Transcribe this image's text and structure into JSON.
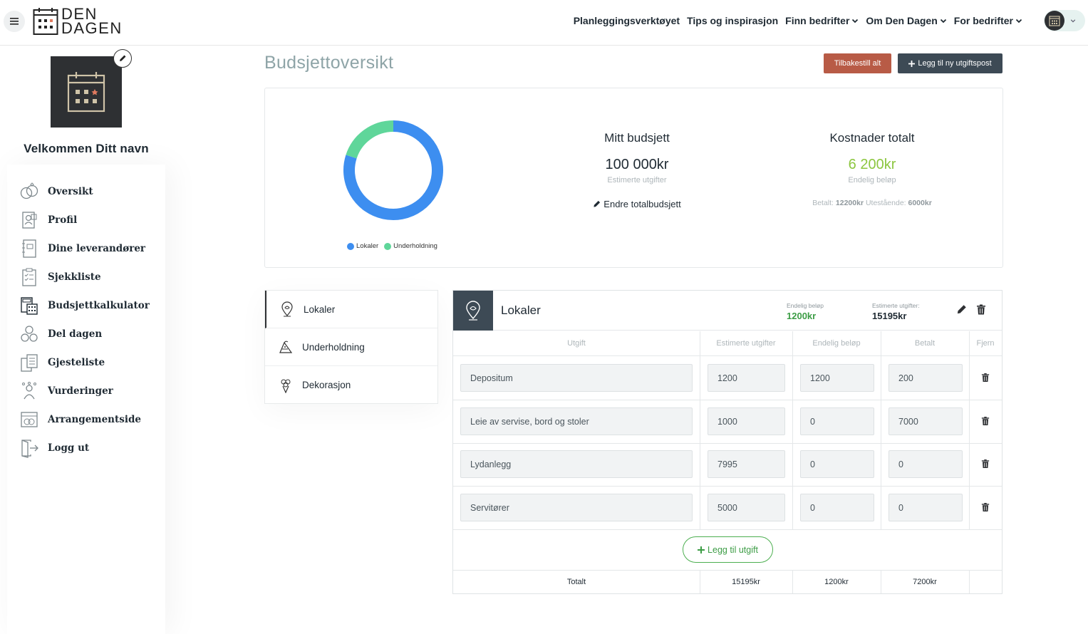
{
  "header": {
    "logo_line1": "DEN",
    "logo_line2": "DAGEN",
    "nav": [
      {
        "label": "Planleggingsverktøyet",
        "dropdown": false
      },
      {
        "label": "Tips og inspirasjon",
        "dropdown": false
      },
      {
        "label": "Finn bedrifter",
        "dropdown": true
      },
      {
        "label": "Om Den Dagen",
        "dropdown": true
      },
      {
        "label": "For bedrifter",
        "dropdown": true
      }
    ]
  },
  "sidebar": {
    "welcome": "Velkommen Ditt navn",
    "items": [
      {
        "label": "Oversikt",
        "icon": "rings-icon"
      },
      {
        "label": "Profil",
        "icon": "profile-icon"
      },
      {
        "label": "Dine leverandører",
        "icon": "notebook-icon"
      },
      {
        "label": "Sjekkliste",
        "icon": "checklist-icon"
      },
      {
        "label": "Budsjettkalkulator",
        "icon": "calculator-icon"
      },
      {
        "label": "Del dagen",
        "icon": "share-icon"
      },
      {
        "label": "Gjesteliste",
        "icon": "guestlist-icon"
      },
      {
        "label": "Vurderinger",
        "icon": "rating-icon"
      },
      {
        "label": "Arrangementside",
        "icon": "event-page-icon"
      },
      {
        "label": "Logg ut",
        "icon": "logout-icon"
      }
    ]
  },
  "main": {
    "title": "Budsjettoversikt",
    "reset_label": "Tilbakestill alt",
    "add_post_label": "Legg til ny utgiftspost"
  },
  "summary": {
    "budget_title": "Mitt budsjett",
    "budget_value": "100 000kr",
    "budget_sub": "Estimerte utgifter",
    "edit_total": "Endre totalbudsjett",
    "cost_title": "Kostnader totalt",
    "cost_value": "6 200kr",
    "cost_sub": "Endelig beløp",
    "paid_label": "Betalt:",
    "paid_value": "12200kr",
    "outstanding_label": "Utestående:",
    "outstanding_value": "6000kr",
    "legend": [
      {
        "label": "Lokaler",
        "color": "#3d8ef0"
      },
      {
        "label": "Underholdning",
        "color": "#5fd69a"
      }
    ]
  },
  "chart_data": {
    "type": "pie",
    "categories": [
      "Lokaler",
      "Underholdning"
    ],
    "values": [
      80,
      20
    ],
    "colors": [
      "#3d8ef0",
      "#5fd69a"
    ],
    "donut": true
  },
  "categories": [
    {
      "label": "Lokaler",
      "icon": "location-pin-icon",
      "active": true
    },
    {
      "label": "Underholdning",
      "icon": "entertainment-icon",
      "active": false
    },
    {
      "label": "Dekorasjon",
      "icon": "bouquet-icon",
      "active": false
    }
  ],
  "detail": {
    "title": "Lokaler",
    "final_label": "Endelig beløp",
    "final_value": "1200kr",
    "estimated_label": "Estimerte utgifter:",
    "estimated_value": "15195kr",
    "columns": [
      "Utgift",
      "Estimerte utgifter",
      "Endelig beløp",
      "Betalt",
      "Fjern"
    ],
    "rows": [
      {
        "name": "Depositum",
        "estimated": "1200",
        "final": "1200",
        "paid": "200"
      },
      {
        "name": "Leie av servise, bord og stoler",
        "estimated": "1000",
        "final": "0",
        "paid": "7000"
      },
      {
        "name": "Lydanlegg",
        "estimated": "7995",
        "final": "0",
        "paid": "0"
      },
      {
        "name": "Servitører",
        "estimated": "5000",
        "final": "0",
        "paid": "0"
      }
    ],
    "add_expense_label": "Legg til utgift",
    "total_label": "Totalt",
    "total_estimated": "15195kr",
    "total_final": "1200kr",
    "total_paid": "7200kr"
  },
  "colors": {
    "accent_dark": "#3d4a55",
    "reset_button": "#b85b46",
    "cost_green": "#8cc63f",
    "final_green": "#3d9d46",
    "title_grey": "#8ea4a7"
  }
}
